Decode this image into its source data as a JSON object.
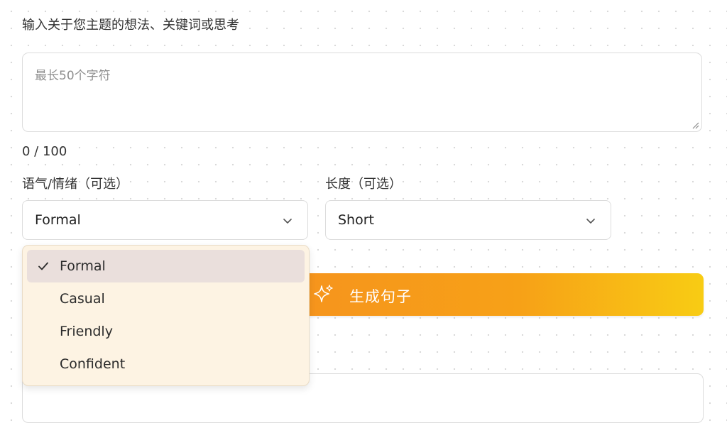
{
  "prompt": {
    "label": "输入关于您主题的想法、关键词或思考",
    "placeholder": "最长50个字符",
    "counter": "0 / 100"
  },
  "tone": {
    "label": "语气/情绪（可选）",
    "selected": "Formal",
    "options": [
      "Formal",
      "Casual",
      "Friendly",
      "Confident"
    ]
  },
  "length": {
    "label": "长度（可选）",
    "selected": "Short"
  },
  "generate_button": {
    "label": "生成句子",
    "icon": "sparkle-icon"
  },
  "colors": {
    "button_gradient_start": "#f6941d",
    "button_gradient_end": "#f8cc14",
    "dropdown_bg": "#fdf3e3",
    "selected_option_bg": "#eadfdc"
  }
}
